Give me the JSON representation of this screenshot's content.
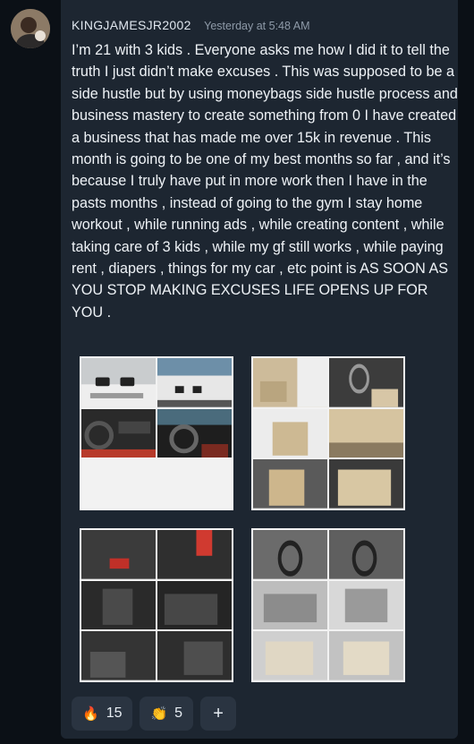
{
  "post": {
    "username": "KINGJAMESJR2002",
    "timestamp": "Yesterday at 5:48 AM",
    "body": "I’m 21 with 3 kids . Everyone asks me how I did it to tell the truth I just didn’t make excuses . This was supposed to be a side hustle but by using moneybags side hustle process and business mastery to create something from 0 I have created a business that has made me over 15k in revenue . This month is going to be one of my best months so far , and it’s because I truly have put in more work then I have in the pasts months , instead of going to the gym I stay home workout , while running ads , while creating content , while taking care of 3 kids , while my gf still works , while paying rent , diapers , things for my car , etc point is AS SOON AS YOU STOP MAKING EXCUSES LIFE OPENS UP FOR YOU ."
  },
  "images": [
    {
      "name": "bmw-exterior-interior-collage"
    },
    {
      "name": "white-car-tan-interior-collage"
    },
    {
      "name": "black-leather-interior-collage"
    },
    {
      "name": "gray-dashboard-console-collage"
    }
  ],
  "reactions": {
    "fire": {
      "icon": "🔥",
      "count": "15"
    },
    "clap": {
      "icon": "👏",
      "count": "5"
    },
    "add_label": "+"
  },
  "colors": {
    "background": "#0b1016",
    "card": "#1d2631",
    "reaction_bg": "#2a3441",
    "username": "#dfe6ee",
    "timestamp": "#8e9aa8"
  }
}
